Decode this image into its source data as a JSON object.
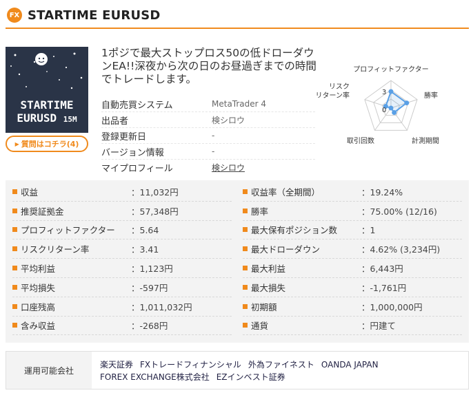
{
  "header": {
    "badge": "FX",
    "title": "STARTIME EURUSD"
  },
  "thumbnail": {
    "line1": "STARTIME",
    "line2": "EURUSD",
    "line2_suffix": "15M"
  },
  "question_button": "質問はコチラ(4)",
  "description": "1ポジで最大ストップロス50の低ドローダウンEA!!深夜から次の日のお昼過ぎまでの時間でトレードします。",
  "info": [
    {
      "label": "自動売買システム",
      "value": "MetaTrader 4"
    },
    {
      "label": "出品者",
      "value": "検シロウ"
    },
    {
      "label": "登録更新日",
      "value": "-"
    },
    {
      "label": "バージョン情報",
      "value": "-"
    },
    {
      "label": "マイプロフィール",
      "value": "検シロウ"
    }
  ],
  "radar": {
    "axes": [
      "プロフィットファクター",
      "勝率",
      "計測期間",
      "取引回数",
      "リスクリターン率"
    ],
    "tick_labels": [
      "3",
      "0"
    ],
    "values": [
      3,
      3,
      1,
      0,
      1
    ],
    "max": 5,
    "color": "#5aa0e6"
  },
  "stats": {
    "left": [
      {
        "label": "収益",
        "value": "：11,032円"
      },
      {
        "label": "推奨証拠金",
        "value": "：57,348円"
      },
      {
        "label": "プロフィットファクター",
        "value": "：5.64"
      },
      {
        "label": "リスクリターン率",
        "value": "：3.41"
      },
      {
        "label": "平均利益",
        "value": "：1,123円"
      },
      {
        "label": "平均損失",
        "value": "：-597円"
      },
      {
        "label": "口座残高",
        "value": "：1,011,032円"
      },
      {
        "label": "含み収益",
        "value": "：-268円"
      }
    ],
    "right": [
      {
        "label": "収益率（全期間）",
        "value": "：19.24%"
      },
      {
        "label": "勝率",
        "value": "：75.00% (12/16)"
      },
      {
        "label": "最大保有ポジション数",
        "value": "：1"
      },
      {
        "label": "最大ドローダウン",
        "value": "：4.62% (3,234円)"
      },
      {
        "label": "最大利益",
        "value": "：6,443円"
      },
      {
        "label": "最大損失",
        "value": "：-1,761円"
      },
      {
        "label": "初期額",
        "value": "：1,000,000円"
      },
      {
        "label": "通貨",
        "value": "：円建て"
      }
    ]
  },
  "companies": {
    "label": "運用可能会社",
    "line1": [
      "楽天証券",
      "FXトレードフィナンシャル",
      "外為ファイネスト",
      "OANDA JAPAN"
    ],
    "line2": [
      "FOREX EXCHANGE株式会社",
      "EZインベスト証券"
    ]
  },
  "colors": {
    "accent": "#f08a1c",
    "thumb_bg": "#2a3447",
    "stats_bg": "#f3f3f3"
  }
}
